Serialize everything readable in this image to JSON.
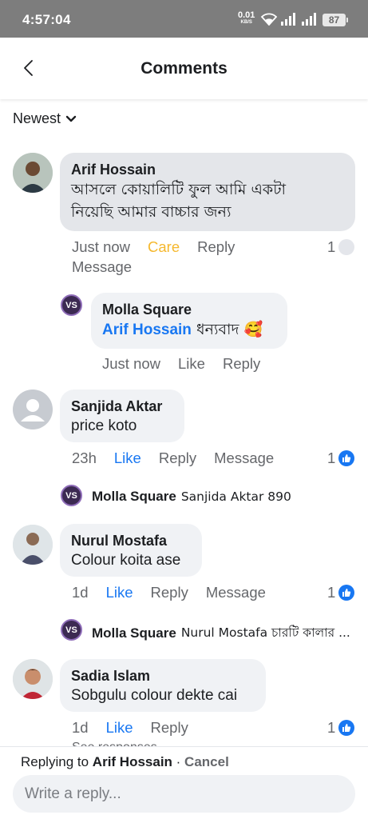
{
  "status": {
    "time": "4:57:04",
    "net_speed": "0.01",
    "net_unit": "KB/S",
    "battery": "87"
  },
  "header": {
    "title": "Comments",
    "back_icon": "chevron-left-icon"
  },
  "sort": {
    "label": "Newest"
  },
  "comments": [
    {
      "name": "Arif Hossain",
      "text_line1": "আসলে কোয়ালিটি ফুল আমি একটা",
      "text_line2": "নিয়েছি আমার বাচ্চার জন্য",
      "time": "Just now",
      "reaction": "Care",
      "reply": "Reply",
      "count": "1",
      "message": "Message"
    },
    {
      "name": "Sanjida Aktar",
      "text": "price koto",
      "time": "23h",
      "like": "Like",
      "reply": "Reply",
      "message": "Message",
      "count": "1"
    },
    {
      "name": "Nurul Mostafa",
      "text": "Colour koita ase",
      "time": "1d",
      "like": "Like",
      "reply": "Reply",
      "message": "Message",
      "count": "1"
    },
    {
      "name": "Sadia Islam",
      "text": "Sobgulu colour dekte cai",
      "time": "1d",
      "like": "Like",
      "reply": "Reply",
      "count": "1",
      "see_more": "See responses"
    }
  ],
  "replies": [
    {
      "name": "Molla Square",
      "mention": "Arif Hossain",
      "text": "ধন্যবাদ 🥰",
      "time": "Just now",
      "like": "Like",
      "reply": "Reply"
    },
    {
      "name": "Molla Square",
      "text": "Sanjida Aktar 890"
    },
    {
      "name": "Molla Square",
      "text": "Nurul Mostafa চারটি কালার ..."
    }
  ],
  "footer": {
    "replying_prefix": "Replying to",
    "replying_name": "Arif Hossain",
    "separator": " · ",
    "cancel": "Cancel",
    "placeholder": "Write a reply..."
  },
  "colors": {
    "accent": "#1877f2",
    "care": "#f5b82e",
    "bubble": "#f0f2f5",
    "muted": "#65676b"
  }
}
